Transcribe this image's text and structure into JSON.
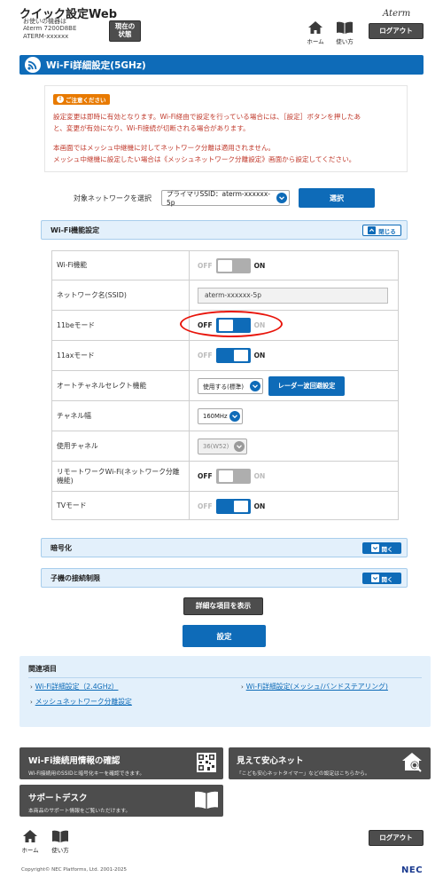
{
  "header": {
    "title": "クイック設定Web",
    "device_line1": "お使いの機器は",
    "device_line2": "Aterm 7200D8BE",
    "device_line3": "ATERM-xxxxxx",
    "status_btn_line1": "現在の",
    "status_btn_line2": "状態",
    "brand": "Aterm",
    "home_label": "ホーム",
    "manual_label": "使い方",
    "logout_label": "ログアウト"
  },
  "page_title": "Wi-Fi詳細設定(5GHz)",
  "notice": {
    "badge": "ご注意ください",
    "line1": "設定変更は即時に有効となります。Wi-Fi経由で設定を行っている場合には、［設定］ボタンを押したあ",
    "line2": "と、変更が有効になり、Wi-Fi接続が切断される場合があります。",
    "line3": "本画面ではメッシュ中継機に対してネットワーク分離は適用されません。",
    "line4": "メッシュ中継機に設定したい場合は《メッシュネットワーク分離設定》画面から設定してください。"
  },
  "network_select": {
    "label": "対象ネットワークを選択",
    "value": "プライマリSSID：aterm-xxxxxx-5p",
    "button": "選択"
  },
  "wifi_section": {
    "title": "Wi-Fi機能設定",
    "toggle_label": "閉じる"
  },
  "settings": {
    "wifi_function": {
      "label": "Wi-Fi機能",
      "off": "OFF",
      "on": "ON",
      "state": "on"
    },
    "ssid": {
      "label": "ネットワーク名(SSID)",
      "value": "aterm-xxxxxx-5p"
    },
    "mode_11be": {
      "label": "11beモード",
      "off": "OFF",
      "on": "ON",
      "state": "off"
    },
    "mode_11ax": {
      "label": "11axモード",
      "off": "OFF",
      "on": "ON",
      "state": "on"
    },
    "auto_channel": {
      "label": "オートチャネルセレクト機能",
      "value": "使用する(標準)",
      "button": "レーダー波回避設定"
    },
    "channel_width": {
      "label": "チャネル幅",
      "value": "160MHz"
    },
    "channel": {
      "label": "使用チャネル",
      "value": "36(W52)"
    },
    "remote_work": {
      "label_line1": "リモートワークWi-Fi(ネットワーク分離",
      "label_line2": "機能)",
      "off": "OFF",
      "on": "ON",
      "state": "off"
    },
    "tv_mode": {
      "label": "TVモード",
      "off": "OFF",
      "on": "ON",
      "state": "on"
    }
  },
  "encryption_section": {
    "title": "暗号化",
    "toggle_label": "開く"
  },
  "client_section": {
    "title": "子機の接続制限",
    "toggle_label": "開く"
  },
  "show_detail_button": "詳細な項目を表示",
  "apply_button": "設定",
  "related": {
    "title": "関連項目",
    "links": [
      "Wi-Fi詳細設定（2.4GHz）",
      "Wi-Fi詳細設定(メッシュ/バンドステアリング)",
      "メッシュネットワーク分離設定"
    ]
  },
  "cards": {
    "wifi_info": {
      "title": "Wi-Fi接続用情報の確認",
      "sub": "Wi-Fi接続用のSSIDと暗号化キーを確認できます。"
    },
    "safe_net": {
      "title": "見えて安心ネット",
      "sub": "「こども安心ネットタイマー」などの設定はこちらから。"
    },
    "support": {
      "title": "サポートデスク",
      "sub": "本商品のサポート情報をご覧いただけます。"
    }
  },
  "footer": {
    "home_label": "ホーム",
    "manual_label": "使い方",
    "logout_label": "ログアウト",
    "copyright": "Copyright© NEC Platforms, Ltd. 2001-2025",
    "logo": "NEC"
  },
  "colors": {
    "accent": "#0e6bb8",
    "notice_text": "#c0392b",
    "badge": "#e87a00",
    "highlight_ring": "#e8140a"
  }
}
